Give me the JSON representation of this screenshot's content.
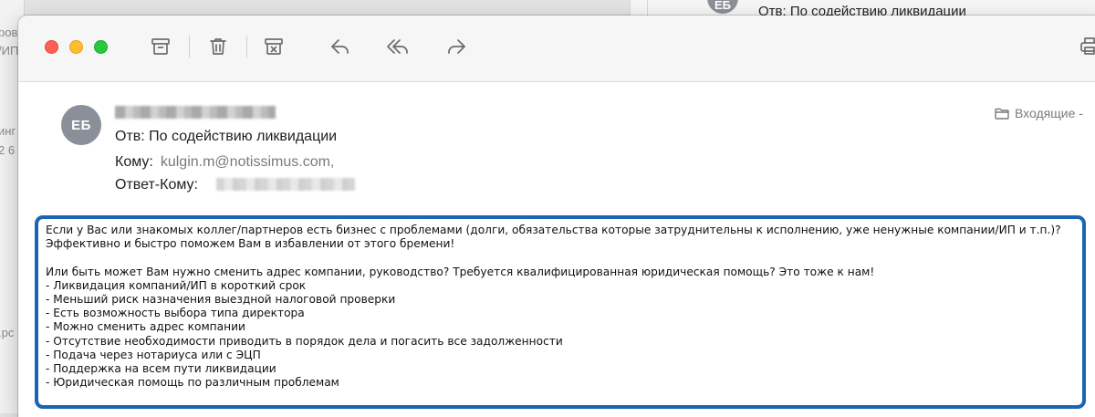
{
  "background_window": {
    "left_fragments": [
      "ров",
      "/ИП",
      "инг",
      "2 6",
      ".pc"
    ],
    "avatar_initials": "ЕБ",
    "subject": "Отв: По содействию ликвидации"
  },
  "window": {
    "traffic_lights": [
      "close",
      "minimize",
      "zoom"
    ],
    "toolbar": [
      "archive-icon",
      "trash-icon",
      "junk-icon",
      "reply-icon",
      "reply-all-icon",
      "forward-icon",
      "print-icon"
    ]
  },
  "message": {
    "avatar_initials": "ЕБ",
    "subject": "Отв: По содействию ликвидации",
    "to_label": "Кому:",
    "to_value": "kulgin.m@notissimus.com,",
    "reply_to_label": "Ответ-Кому:",
    "mailbox": "Входящие -",
    "body": {
      "p1": "Если у Вас или знакомых коллег/партнеров есть бизнес с проблемами (долги, обязательства которые затруднительны к исполнению, уже ненужные компании/ИП и т.п.)?",
      "p2": "Эффективно и быстро поможем Вам в избавлении от этого бремени!",
      "p3": "Или быть может Вам нужно сменить адрес компании, руководство? Требуется квалифицированная юридическая помощь? Это тоже к нам!",
      "list": [
        "- Ликвидация компаний/ИП в короткий срок",
        "- Меньший риск назначения выездной налоговой проверки",
        "- Есть возможность выбора типа директора",
        "- Можно сменить адрес компании",
        "- Отсутствие необходимости приводить в порядок дела и погасить все задолженности",
        "- Подача через нотариуса или с ЭЦП",
        "- Поддержка на всем пути ликвидации",
        "- Юридическая помощь по различным проблемам"
      ]
    }
  },
  "colors": {
    "highlight_border": "#1b64b2",
    "avatar_bg": "#8b8f99"
  }
}
